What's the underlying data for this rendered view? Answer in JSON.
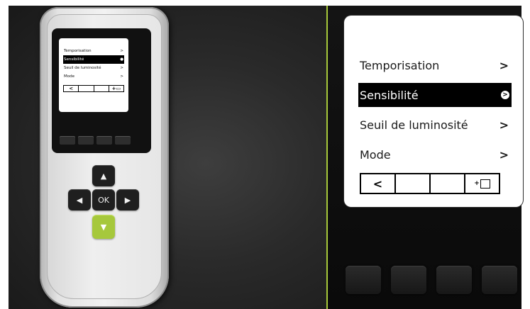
{
  "menu": {
    "items": [
      {
        "label": "Temporisation",
        "chevron": ">"
      },
      {
        "label": "Sensibilité",
        "chevron": ">"
      },
      {
        "label": "Seuil de luminosité",
        "chevron": ">"
      },
      {
        "label": "Mode",
        "chevron": ">"
      }
    ],
    "selected_index": 1,
    "nav": {
      "back_glyph": "<",
      "enter_glyph": "+"
    }
  },
  "remote": {
    "ok_label": "OK",
    "up_glyph": "▲",
    "down_glyph": "▼",
    "left_glyph": "◀",
    "right_glyph": "▶"
  },
  "colors": {
    "accent_green": "#a6c83c",
    "divider_green": "#a7c93a",
    "selection_bg": "#000000"
  },
  "icons": {
    "chevron": "chevron-right-icon",
    "selected": "circle-arrow-icon",
    "back": "chevron-left-icon",
    "enter": "enter-icon"
  }
}
